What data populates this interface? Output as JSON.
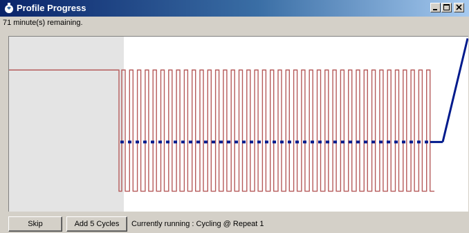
{
  "window": {
    "title": "Profile Progress",
    "controls": {
      "minimize": "minimize",
      "maximize": "maximize",
      "close": "close"
    }
  },
  "status": {
    "remaining": "71 minute(s) remaining."
  },
  "buttons": {
    "skip": "Skip",
    "add_cycles": "Add 5 Cycles"
  },
  "running": {
    "text": "Currently running : Cycling @ Repeat 1"
  },
  "colors": {
    "titlebar_start": "#0a246a",
    "titlebar_end": "#a6caf0",
    "setpoint_line": "#b55a5a",
    "actual_line": "#001a8c",
    "completed_region": "#e4e4e4"
  },
  "chart_data": {
    "type": "line",
    "title": "",
    "xlabel": "",
    "ylabel": "",
    "grid": false,
    "legend": "none",
    "completed_fraction": 0.25,
    "series": [
      {
        "role": "profile-setpoint",
        "shape": "initial hold then square-wave cycling",
        "initial_hold": 0.81,
        "cycle_high": 0.81,
        "cycle_low": 0.12,
        "cycles": 40
      },
      {
        "role": "actual-progress",
        "shape": "dashed flat line then rising ramp",
        "level": 0.4,
        "ramp_end": 0.99
      }
    ]
  }
}
